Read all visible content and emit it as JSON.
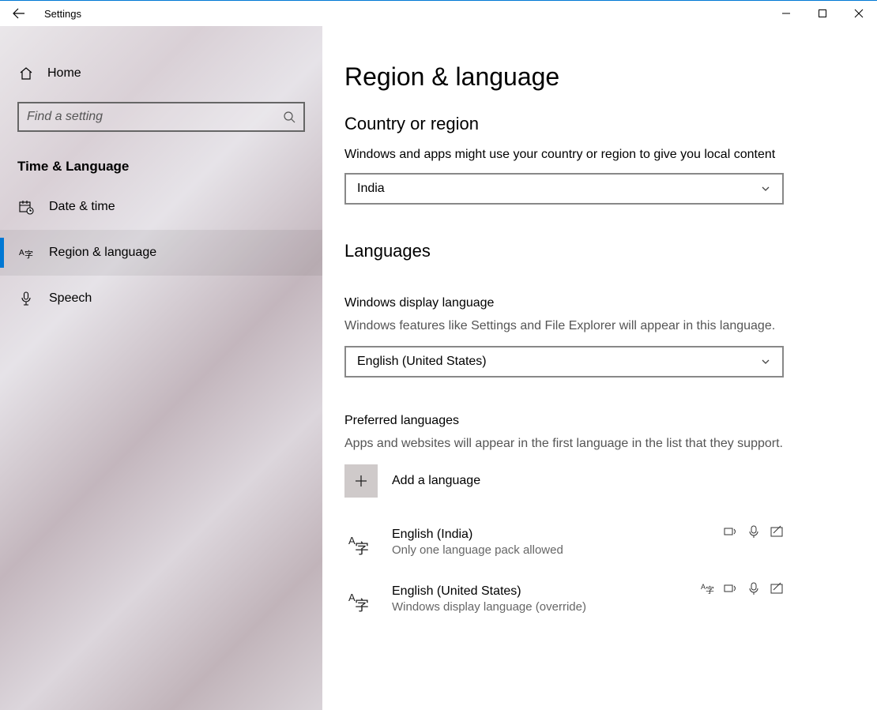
{
  "titlebar": {
    "title": "Settings"
  },
  "sidebar": {
    "home": "Home",
    "search_placeholder": "Find a setting",
    "category": "Time & Language",
    "items": [
      {
        "label": "Date & time"
      },
      {
        "label": "Region & language"
      },
      {
        "label": "Speech"
      }
    ]
  },
  "content": {
    "page_title": "Region & language",
    "region": {
      "heading": "Country or region",
      "desc": "Windows and apps might use your country or region to give you local content",
      "value": "India"
    },
    "languages": {
      "heading": "Languages",
      "display": {
        "sub": "Windows display language",
        "desc": "Windows features like Settings and File Explorer will appear in this language.",
        "value": "English (United States)"
      },
      "preferred": {
        "sub": "Preferred languages",
        "desc": "Apps and websites will appear in the first language in the list that they support.",
        "add_label": "Add a language",
        "items": [
          {
            "name": "English (India)",
            "sub": "Only one language pack allowed"
          },
          {
            "name": "English (United States)",
            "sub": "Windows display language (override)"
          }
        ]
      }
    }
  }
}
